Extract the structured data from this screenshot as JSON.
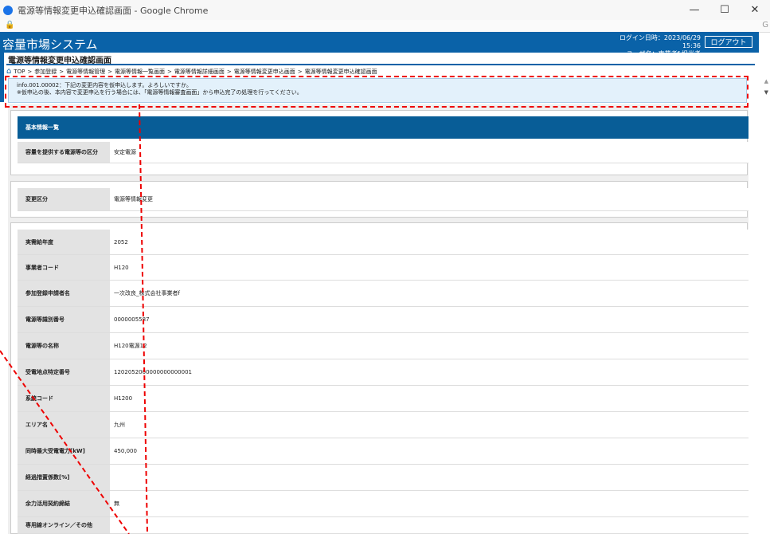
{
  "browser": {
    "title": "電源等情報変更申込確認画面 - Google Chrome",
    "minimize": "—",
    "maximize": "☐",
    "close": "✕",
    "lock": "🔒",
    "edge_glyph": "G"
  },
  "app": {
    "title": "容量市場システム",
    "login_datetime": "ログイン日時：2023/06/29 15:36",
    "user_name": "ユーザ名：事業者f 担当者",
    "logout": "ログアウト"
  },
  "page": {
    "title": "電源等情報変更申込確認画面"
  },
  "breadcrumb": [
    "TOP",
    "参加登録",
    "電源等情報管理",
    "電源等情報一覧画面",
    "電源等情報詳細画面",
    "電源等情報変更申込画面",
    "電源等情報変更申込確認画面"
  ],
  "message": {
    "line1": "info.001.00002：下記の変更内容を仮申込します。よろしいですか。",
    "line2": "※仮申込の後、本内容で変更申込を行う場合には、「電源等情報審査画面」から申込完了の処理を行ってください。"
  },
  "section": {
    "title": "基本情報一覧"
  },
  "provider_row": {
    "label": "容量を提供する電源等の区分",
    "value": "安定電源"
  },
  "change_row": {
    "label": "変更区分",
    "value": "電源等情報変更"
  },
  "details": [
    {
      "label": "実需給年度",
      "value": "2052"
    },
    {
      "label": "事業者コード",
      "value": "H120"
    },
    {
      "label": "参加登録申請者名",
      "value": "一次改良_株式会社事業者f"
    },
    {
      "label": "電源等識別番号",
      "value": "0000005587"
    },
    {
      "label": "電源等の名称",
      "value": "H120電源12"
    },
    {
      "label": "受電地点特定番号",
      "value": "1202052000000000000001"
    },
    {
      "label": "系統コード",
      "value": "H1200"
    },
    {
      "label": "エリア名",
      "value": "九州"
    },
    {
      "label": "同時最大受電電力[kW]",
      "value": "450,000"
    },
    {
      "label": "経過措置係数[%]",
      "value": ""
    },
    {
      "label": "余力活用契約締結",
      "value": "無"
    },
    {
      "label": "専用線オンライン／その他",
      "value": ""
    }
  ],
  "colors": {
    "header_blue": "#0a62a8",
    "section_blue": "#085d97",
    "annotation_red": "#e00000",
    "message_bg": "#e3f1fb"
  }
}
